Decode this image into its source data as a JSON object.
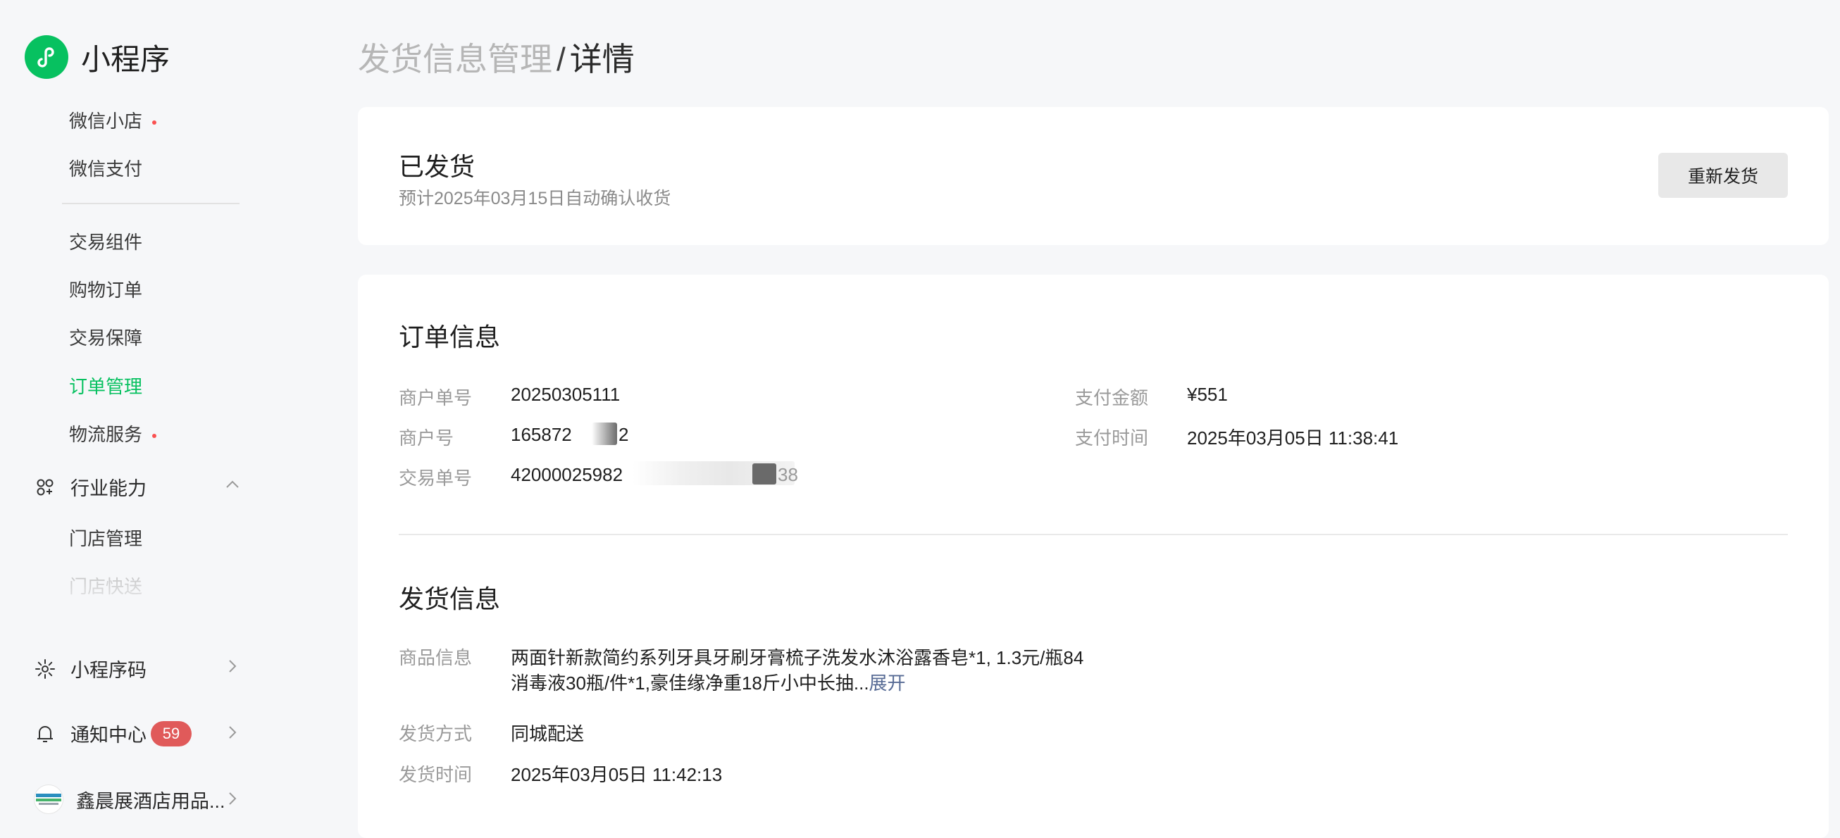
{
  "brand": {
    "title": "小程序",
    "icon": "mini-program-logo-icon"
  },
  "sidebar": {
    "items_top": [
      {
        "label": "微信小店",
        "dot": true
      },
      {
        "label": "微信支付",
        "dot": false
      }
    ],
    "items_trade": [
      {
        "label": "交易组件"
      },
      {
        "label": "购物订单"
      },
      {
        "label": "交易保障"
      },
      {
        "label": "订单管理",
        "active": true
      },
      {
        "label": "物流服务",
        "dot": true
      }
    ],
    "industry": {
      "label": "行业能力",
      "icon": "industry-capability-icon",
      "items": [
        {
          "label": "门店管理"
        },
        {
          "label": "门店快送"
        }
      ]
    },
    "qrcode": {
      "label": "小程序码",
      "icon": "qrcode-sun-icon"
    },
    "notifications": {
      "label": "通知中心",
      "badge": "59",
      "icon": "bell-icon"
    },
    "account": {
      "label": "鑫晨展酒店用品...",
      "icon": "account-avatar"
    }
  },
  "breadcrumb": {
    "parent": "发货信息管理",
    "separator": "/",
    "current": "详情"
  },
  "status": {
    "title": "已发货",
    "subtitle": "预计2025年03月15日自动确认收货",
    "reship_label": "重新发货"
  },
  "order_info": {
    "title": "订单信息",
    "merchant_order_label": "商户单号",
    "merchant_order_value": "20250305111",
    "merchant_id_label": "商户号",
    "merchant_id_value": "165872",
    "merchant_id_suffix": "2",
    "trade_no_label": "交易单号",
    "trade_no_value": "42000025982",
    "trade_no_suffix": "38",
    "amount_label": "支付金额",
    "amount_value": "¥551",
    "pay_time_label": "支付时间",
    "pay_time_value": "2025年03月05日 11:38:41"
  },
  "shipping_info": {
    "title": "发货信息",
    "goods_label": "商品信息",
    "goods_line1": "两面针新款简约系列牙具牙刷牙膏梳子洗发水沐浴露香皂*1, 1.3元/瓶84",
    "goods_line2": "消毒液30瓶/件*1,豪佳缘净重18斤小中长抽...",
    "expand_label": "展开",
    "method_label": "发货方式",
    "method_value": "同城配送",
    "ship_time_label": "发货时间",
    "ship_time_value": "2025年03月05日 11:42:13"
  },
  "colors": {
    "brand_green": "#07c160",
    "active_green": "#07c160",
    "badge_red": "#e05a5a",
    "dot_red": "#fa5151",
    "link_blue": "#576b95",
    "page_bg": "#f6f7f9"
  }
}
